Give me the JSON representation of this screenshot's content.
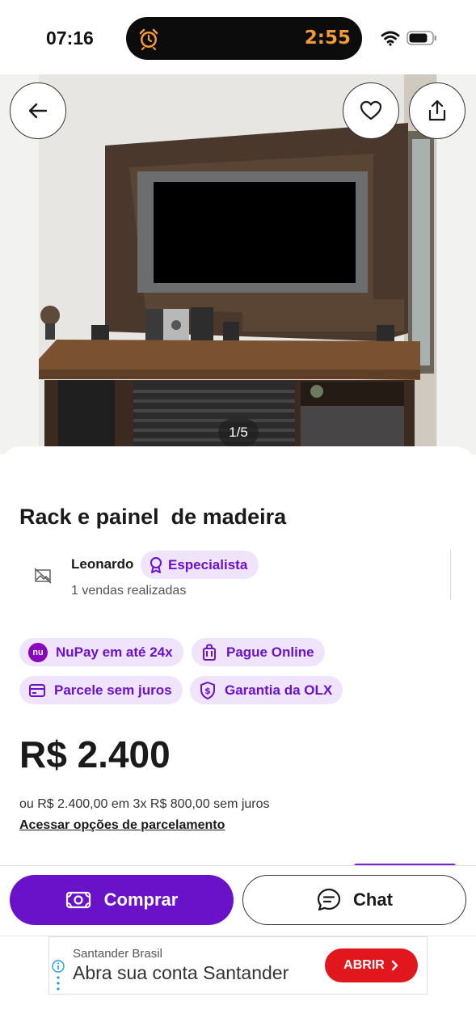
{
  "status_bar": {
    "time": "07:16",
    "timer": "2:55",
    "icons": [
      "alarm-clock-icon",
      "wifi-icon",
      "battery-icon"
    ]
  },
  "gallery": {
    "counter": "1/5",
    "buttons": [
      "back-arrow-icon",
      "heart-icon",
      "share-icon"
    ]
  },
  "listing": {
    "title": "Rack e painel  de madeira",
    "seller": {
      "name": "Leonardo",
      "badge": "Especialista",
      "sales": "1 vendas realizadas"
    },
    "chips": {
      "nupay": "NuPay em até 24x",
      "nupay_logo": "nu",
      "online": "Pague Online",
      "parcele": "Parcele sem juros",
      "garantia": "Garantia da OLX"
    },
    "price": "R$ 2.400",
    "installments": "ou R$ 2.400,00 em 3x R$ 800,00 sem juros",
    "installments_link": "Acessar opções de parcelamento"
  },
  "actions": {
    "buy": "Comprar",
    "chat": "Chat"
  },
  "ad": {
    "advertiser": "Santander Brasil",
    "headline": "Abra sua conta Santander",
    "cta": "ABRIR"
  },
  "colors": {
    "brand_purple": "#6a12c9",
    "chip_bg": "#efe4fb",
    "ad_red": "#e2161d",
    "timer_orange": "#f29a38"
  }
}
